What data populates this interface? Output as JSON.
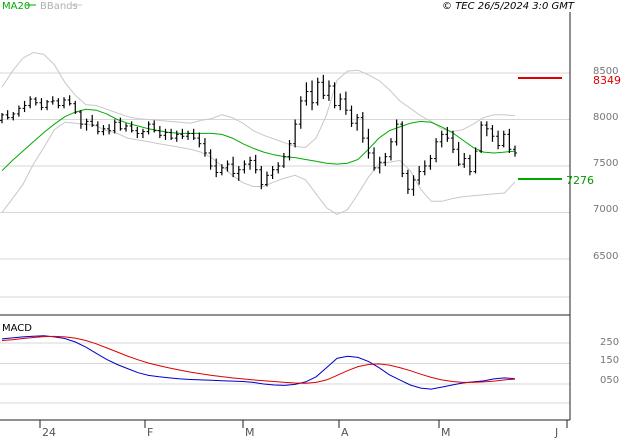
{
  "header": {
    "ma_label": "MA20",
    "bbands_label": "BBands",
    "source": "© TEC 26/5/2024 3:0 GMT"
  },
  "colors": {
    "price": "#000000",
    "ma20": "#00aa00",
    "bbands": "#c8c8c8",
    "grid": "#d7d7d7",
    "resistance": "#dd0000",
    "support": "#00aa00",
    "macd": "#0000cc",
    "signal": "#dd0000"
  },
  "chart_data": [
    {
      "type": "ohlc",
      "panel": "price",
      "y_ticks": [
        "8500",
        "8000",
        "7500",
        "7000",
        "6500"
      ],
      "y_tick_values": [
        8500,
        8000,
        7500,
        7000,
        6500
      ],
      "ylim": [
        6000,
        8800
      ],
      "x_labels": [
        "24",
        "F",
        "M",
        "A",
        "M",
        "J"
      ],
      "legend": [
        "MA20",
        "BBands"
      ],
      "grid": true,
      "annotations": {
        "resistance": {
          "value": 8349,
          "label": "8349"
        },
        "support": {
          "value": 7276,
          "label": "7276"
        }
      },
      "series": [
        {
          "name": "MA20",
          "values": [
            7450,
            7560,
            7660,
            7760,
            7860,
            7950,
            8030,
            8080,
            8110,
            8100,
            8060,
            8000,
            7960,
            7930,
            7900,
            7880,
            7860,
            7850,
            7850,
            7850,
            7850,
            7840,
            7800,
            7740,
            7690,
            7650,
            7620,
            7600,
            7590,
            7570,
            7550,
            7530,
            7520,
            7530,
            7570,
            7680,
            7800,
            7880,
            7920,
            7960,
            7980,
            7970,
            7920,
            7860,
            7780,
            7700,
            7650,
            7640,
            7650,
            7660
          ]
        },
        {
          "name": "BBands upper",
          "values": [
            8350,
            8520,
            8660,
            8720,
            8700,
            8590,
            8400,
            8260,
            8160,
            8150,
            8110,
            8070,
            8030,
            8010,
            8000,
            7990,
            7980,
            7970,
            7960,
            7990,
            8010,
            8050,
            8020,
            7960,
            7880,
            7830,
            7790,
            7750,
            7710,
            7700,
            7800,
            8050,
            8420,
            8520,
            8530,
            8480,
            8420,
            8320,
            8200,
            8120,
            8040,
            7980,
            7900,
            7870,
            7890,
            7950,
            8020,
            8050,
            8050,
            8040
          ]
        },
        {
          "name": "BBands lower",
          "values": [
            7000,
            7150,
            7300,
            7520,
            7700,
            7890,
            7970,
            7960,
            7950,
            7930,
            7880,
            7850,
            7800,
            7780,
            7760,
            7740,
            7720,
            7700,
            7680,
            7650,
            7590,
            7500,
            7400,
            7320,
            7280,
            7280,
            7330,
            7370,
            7400,
            7350,
            7200,
            7050,
            6980,
            7030,
            7200,
            7380,
            7520,
            7540,
            7560,
            7450,
            7250,
            7120,
            7120,
            7150,
            7170,
            7180,
            7190,
            7200,
            7210,
            7330
          ]
        }
      ],
      "ohlc": [
        [
          7990,
          8070,
          7960,
          8050
        ],
        [
          8050,
          8100,
          8000,
          8020
        ],
        [
          8020,
          8080,
          7990,
          8060
        ],
        [
          8060,
          8150,
          8030,
          8120
        ],
        [
          8120,
          8200,
          8080,
          8150
        ],
        [
          8150,
          8250,
          8120,
          8220
        ],
        [
          8220,
          8240,
          8150,
          8180
        ],
        [
          8180,
          8230,
          8100,
          8130
        ],
        [
          8130,
          8210,
          8100,
          8190
        ],
        [
          8190,
          8250,
          8160,
          8200
        ],
        [
          8200,
          8230,
          8120,
          8150
        ],
        [
          8150,
          8240,
          8120,
          8210
        ],
        [
          8210,
          8260,
          8150,
          8170
        ],
        [
          8170,
          8200,
          8060,
          8080
        ],
        [
          8080,
          8100,
          7900,
          7950
        ],
        [
          7950,
          8010,
          7880,
          7980
        ],
        [
          7980,
          8050,
          7920,
          7940
        ],
        [
          7940,
          7980,
          7840,
          7870
        ],
        [
          7870,
          7940,
          7830,
          7900
        ],
        [
          7900,
          7950,
          7840,
          7880
        ],
        [
          7880,
          8000,
          7850,
          7970
        ],
        [
          7970,
          8020,
          7880,
          7900
        ],
        [
          7900,
          7960,
          7870,
          7930
        ],
        [
          7930,
          7980,
          7860,
          7880
        ],
        [
          7880,
          7920,
          7800,
          7850
        ],
        [
          7850,
          7900,
          7800,
          7870
        ],
        [
          7870,
          7980,
          7840,
          7950
        ],
        [
          7950,
          7990,
          7860,
          7880
        ],
        [
          7880,
          7930,
          7800,
          7830
        ],
        [
          7830,
          7900,
          7780,
          7860
        ],
        [
          7860,
          7900,
          7780,
          7800
        ],
        [
          7800,
          7880,
          7760,
          7840
        ],
        [
          7840,
          7900,
          7790,
          7820
        ],
        [
          7820,
          7880,
          7780,
          7850
        ],
        [
          7850,
          7900,
          7780,
          7800
        ],
        [
          7800,
          7860,
          7700,
          7740
        ],
        [
          7740,
          7800,
          7600,
          7640
        ],
        [
          7640,
          7680,
          7460,
          7500
        ],
        [
          7500,
          7580,
          7380,
          7430
        ],
        [
          7430,
          7520,
          7400,
          7480
        ],
        [
          7480,
          7560,
          7440,
          7520
        ],
        [
          7520,
          7600,
          7380,
          7420
        ],
        [
          7420,
          7500,
          7340,
          7460
        ],
        [
          7460,
          7560,
          7420,
          7520
        ],
        [
          7520,
          7600,
          7460,
          7560
        ],
        [
          7560,
          7620,
          7420,
          7460
        ],
        [
          7460,
          7500,
          7250,
          7300
        ],
        [
          7300,
          7440,
          7280,
          7400
        ],
        [
          7400,
          7500,
          7360,
          7460
        ],
        [
          7460,
          7540,
          7420,
          7500
        ],
        [
          7500,
          7640,
          7480,
          7600
        ],
        [
          7600,
          7780,
          7560,
          7740
        ],
        [
          7740,
          8000,
          7700,
          7950
        ],
        [
          7950,
          8250,
          7900,
          8200
        ],
        [
          8200,
          8400,
          8150,
          8300
        ],
        [
          8300,
          8420,
          8100,
          8180
        ],
        [
          8180,
          8450,
          8150,
          8400
        ],
        [
          8400,
          8480,
          8220,
          8260
        ],
        [
          8260,
          8420,
          8200,
          8360
        ],
        [
          8360,
          8400,
          8120,
          8150
        ],
        [
          8150,
          8280,
          8100,
          8220
        ],
        [
          8220,
          8300,
          8050,
          8100
        ],
        [
          8100,
          8150,
          7920,
          7960
        ],
        [
          7960,
          8060,
          7880,
          8020
        ],
        [
          8020,
          8080,
          7750,
          7800
        ],
        [
          7800,
          7900,
          7580,
          7640
        ],
        [
          7640,
          7700,
          7450,
          7480
        ],
        [
          7480,
          7600,
          7420,
          7540
        ],
        [
          7540,
          7640,
          7500,
          7600
        ],
        [
          7600,
          7800,
          7560,
          7760
        ],
        [
          7760,
          8000,
          7720,
          7950
        ],
        [
          7950,
          7980,
          7380,
          7420
        ],
        [
          7420,
          7460,
          7200,
          7250
        ],
        [
          7250,
          7400,
          7180,
          7350
        ],
        [
          7350,
          7500,
          7300,
          7440
        ],
        [
          7440,
          7560,
          7400,
          7500
        ],
        [
          7500,
          7620,
          7460,
          7580
        ],
        [
          7580,
          7800,
          7540,
          7760
        ],
        [
          7760,
          7880,
          7700,
          7840
        ],
        [
          7840,
          7920,
          7760,
          7800
        ],
        [
          7800,
          7880,
          7640,
          7680
        ],
        [
          7680,
          7760,
          7500,
          7520
        ],
        [
          7520,
          7640,
          7480,
          7580
        ],
        [
          7580,
          7620,
          7400,
          7440
        ],
        [
          7440,
          7700,
          7420,
          7660
        ],
        [
          7660,
          7980,
          7640,
          7940
        ],
        [
          7940,
          7980,
          7820,
          7900
        ],
        [
          7900,
          7940,
          7760,
          7820
        ],
        [
          7820,
          7880,
          7680,
          7720
        ],
        [
          7720,
          7880,
          7700,
          7840
        ],
        [
          7840,
          7900,
          7640,
          7680
        ],
        [
          7680,
          7720,
          7600,
          7640
        ]
      ]
    },
    {
      "type": "line",
      "panel": "macd",
      "title": "MACD",
      "y_ticks": [
        "250",
        "150",
        "050"
      ],
      "y_tick_values": [
        250,
        150,
        50
      ],
      "ylim": [
        -10,
        320
      ],
      "x_labels": [
        "24",
        "F",
        "M",
        "A",
        "M",
        "J"
      ],
      "series": [
        {
          "name": "MACD",
          "values": [
            270,
            275,
            280,
            283,
            285,
            280,
            272,
            255,
            230,
            200,
            170,
            145,
            125,
            105,
            92,
            85,
            80,
            75,
            72,
            70,
            68,
            66,
            64,
            62,
            58,
            50,
            45,
            43,
            48,
            60,
            85,
            130,
            175,
            185,
            180,
            160,
            130,
            95,
            70,
            45,
            30,
            25,
            35,
            45,
            55,
            60,
            65,
            75,
            80,
            76
          ]
        },
        {
          "name": "Signal",
          "values": [
            262,
            266,
            272,
            277,
            281,
            282,
            280,
            274,
            262,
            246,
            226,
            206,
            186,
            168,
            152,
            140,
            128,
            118,
            108,
            100,
            92,
            86,
            80,
            75,
            70,
            66,
            62,
            58,
            55,
            54,
            58,
            70,
            92,
            115,
            135,
            145,
            148,
            142,
            130,
            115,
            98,
            82,
            70,
            62,
            58,
            58,
            60,
            64,
            70,
            74
          ]
        }
      ]
    }
  ]
}
